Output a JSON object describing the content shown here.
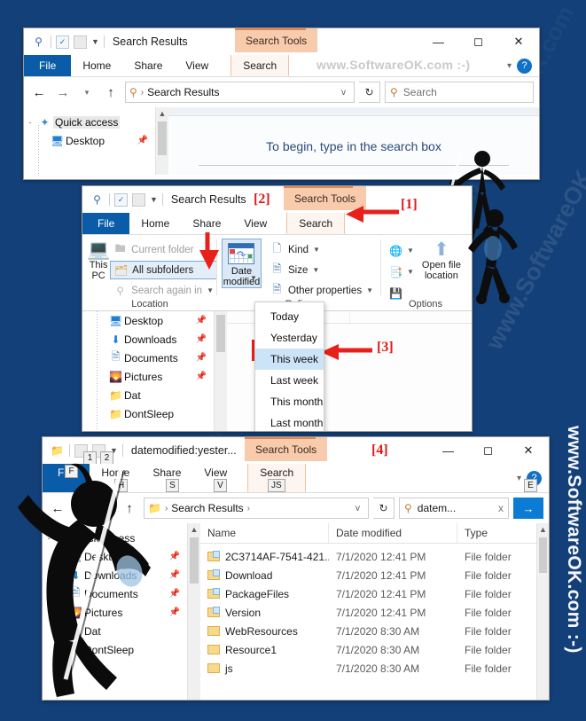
{
  "page": {
    "background_color": "#134078",
    "watermark_right": "www.SoftwareOK.com  :-)",
    "watermark_diagonal": "www.SoftwareOK.com"
  },
  "window_top": {
    "title": "Search Results",
    "contextual_tab": "Search Tools",
    "quick_access": [
      "search-icon",
      "properties-icon",
      "new-folder-icon",
      "customize-caret"
    ],
    "tabs": [
      "File",
      "Home",
      "Share",
      "View",
      "Search"
    ],
    "watermark": "www.SoftwareOK.com  :-)",
    "help_icon": "?",
    "window_controls": [
      "minimize",
      "maximize",
      "close"
    ],
    "address": {
      "crumb_icon": "search-icon",
      "crumb": "Search Results",
      "caret": "v",
      "refresh": "refresh-icon"
    },
    "search": {
      "placeholder": "Search",
      "icon": "search-icon"
    },
    "nav": [
      {
        "label": "Quick access",
        "icon": "pin-star-icon",
        "expander": "-",
        "pin": false,
        "selected": true
      },
      {
        "label": "Desktop",
        "icon": "monitor-icon",
        "pin": true,
        "selected": false
      }
    ],
    "empty_message": "To begin, type in the search box"
  },
  "window_mid": {
    "title": "Search Results",
    "title_annotation": "[2]",
    "contextual_tab": "Search Tools",
    "tabs": [
      "File",
      "Home",
      "Share",
      "View",
      "Search"
    ],
    "active_tab": "Search",
    "annotations": {
      "search_tab": "[1]",
      "this_week": "[3]"
    },
    "ribbon": {
      "groups": [
        {
          "name": "Location",
          "big_button": {
            "label": "This\nPC",
            "icon": "computer-icon"
          },
          "items": [
            {
              "label": "Current folder",
              "icon": "folder-outline-icon",
              "state": "disabled"
            },
            {
              "label": "All subfolders",
              "icon": "subfolder-icon",
              "state": "checked"
            },
            {
              "label": "Search again in",
              "icon": "search-icon",
              "state": "disabled",
              "caret": true
            }
          ]
        },
        {
          "name": "Refine",
          "date_button": {
            "label": "Date\nmodified",
            "icon": "calendar-icon",
            "caret": true
          },
          "items": [
            {
              "label": "Kind",
              "icon": "kind-icon",
              "caret": true
            },
            {
              "label": "Size",
              "icon": "size-icon",
              "caret": true
            },
            {
              "label": "Other properties",
              "icon": "properties-icon",
              "caret": true
            }
          ]
        },
        {
          "name": "Options",
          "items": [
            {
              "label": "",
              "icon": "advanced-options-icon",
              "caret": true
            },
            {
              "label": "",
              "icon": "recent-searches-icon",
              "caret": true
            },
            {
              "label": "",
              "icon": "save-search-icon"
            }
          ],
          "big_button": {
            "label": "Open file\nlocation",
            "icon": "open-location-icon"
          }
        }
      ]
    },
    "date_menu": [
      {
        "label": "Today",
        "highlighted": false
      },
      {
        "label": "Yesterday",
        "highlighted": false
      },
      {
        "label": "This week",
        "highlighted": true
      },
      {
        "label": "Last week",
        "highlighted": false
      },
      {
        "label": "This month",
        "highlighted": false
      },
      {
        "label": "Last month",
        "highlighted": false
      }
    ],
    "nav": [
      {
        "label": "Desktop",
        "icon": "monitor-icon",
        "pin": true
      },
      {
        "label": "Downloads",
        "icon": "download-icon",
        "pin": true
      },
      {
        "label": "Documents",
        "icon": "document-icon",
        "pin": true
      },
      {
        "label": "Pictures",
        "icon": "pictures-icon",
        "pin": true
      },
      {
        "label": "Dat",
        "icon": "folder-icon",
        "pin": false
      },
      {
        "label": "DontSleep",
        "icon": "folder-icon",
        "pin": false
      }
    ]
  },
  "window_bottom": {
    "title": "datemodified:yester...",
    "contextual_tab": "Search Tools",
    "annotation": "[4]",
    "tabs": [
      "File",
      "Home",
      "Share",
      "View",
      "Search"
    ],
    "keytips": {
      "file": "F",
      "home": "H",
      "share": "S",
      "view": "V",
      "search": "JS",
      "qat1": "1",
      "qat2": "2",
      "help": "E"
    },
    "address": {
      "crumb": "Search Results",
      "caret": "v",
      "refresh": "refresh-icon"
    },
    "search": {
      "value": "datem...",
      "clear": "x",
      "go": "go-arrow-icon"
    },
    "nav": [
      {
        "label": "Quick access",
        "icon": "pin-star-icon",
        "expander": "-"
      },
      {
        "label": "Desktop",
        "icon": "monitor-icon",
        "pin": true
      },
      {
        "label": "Downloads",
        "icon": "download-icon",
        "pin": true
      },
      {
        "label": "Documents",
        "icon": "document-icon",
        "pin": true
      },
      {
        "label": "Pictures",
        "icon": "pictures-icon",
        "pin": true
      },
      {
        "label": "Dat",
        "icon": "folder-icon",
        "pin": false
      },
      {
        "label": "DontSleep",
        "icon": "folder-icon",
        "pin": false
      }
    ],
    "columns": [
      "Name",
      "Date modified",
      "Type"
    ],
    "rows": [
      {
        "name": "2C3714AF-7541-421...",
        "date": "7/1/2020 12:41 PM",
        "type": "File folder",
        "icon": "folder-doc-icon"
      },
      {
        "name": "Download",
        "date": "7/1/2020 12:41 PM",
        "type": "File folder",
        "icon": "folder-doc-icon"
      },
      {
        "name": "PackageFiles",
        "date": "7/1/2020 12:41 PM",
        "type": "File folder",
        "icon": "folder-doc-icon"
      },
      {
        "name": "Version",
        "date": "7/1/2020 12:41 PM",
        "type": "File folder",
        "icon": "folder-doc-icon"
      },
      {
        "name": "WebResources",
        "date": "7/1/2020 8:30 AM",
        "type": "File folder",
        "icon": "folder-icon"
      },
      {
        "name": "Resource1",
        "date": "7/1/2020 8:30 AM",
        "type": "File folder",
        "icon": "folder-icon"
      },
      {
        "name": "js",
        "date": "7/1/2020 8:30 AM",
        "type": "File folder",
        "icon": "folder-icon"
      }
    ]
  }
}
